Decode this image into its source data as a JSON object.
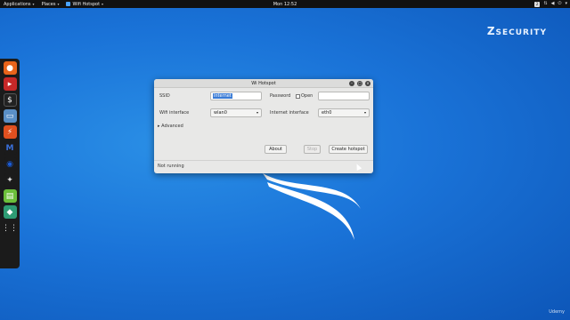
{
  "topbar": {
    "applications": "Applications",
    "places": "Places",
    "app_name": "Wifi Hotspot",
    "clock": "Mon 12:52",
    "badge": "2"
  },
  "brand": {
    "logo_big": "Z",
    "logo_text": "SECURITY"
  },
  "dock": {
    "items": [
      "firefox-icon",
      "terminal-red-icon",
      "terminal-icon",
      "files-icon",
      "burp-icon",
      "metasploit-icon",
      "maltego-icon",
      "beef-icon",
      "notes-icon",
      "app-icon",
      "apps-grid-icon"
    ]
  },
  "window": {
    "title": "Wi Hotspot",
    "ssid_label": "SSID",
    "ssid_value": "internet",
    "password_label": "Password",
    "open_label": "Open",
    "password_value": "",
    "wifi_iface_label": "Wifi interface",
    "wifi_iface_value": "wlan0",
    "inet_iface_label": "Internet interface",
    "inet_iface_value": "eth0",
    "advanced_label": "Advanced",
    "about_btn": "About",
    "stop_btn": "Stop",
    "create_btn": "Create hotspot",
    "status": "Not running"
  },
  "watermark": "Udemy"
}
